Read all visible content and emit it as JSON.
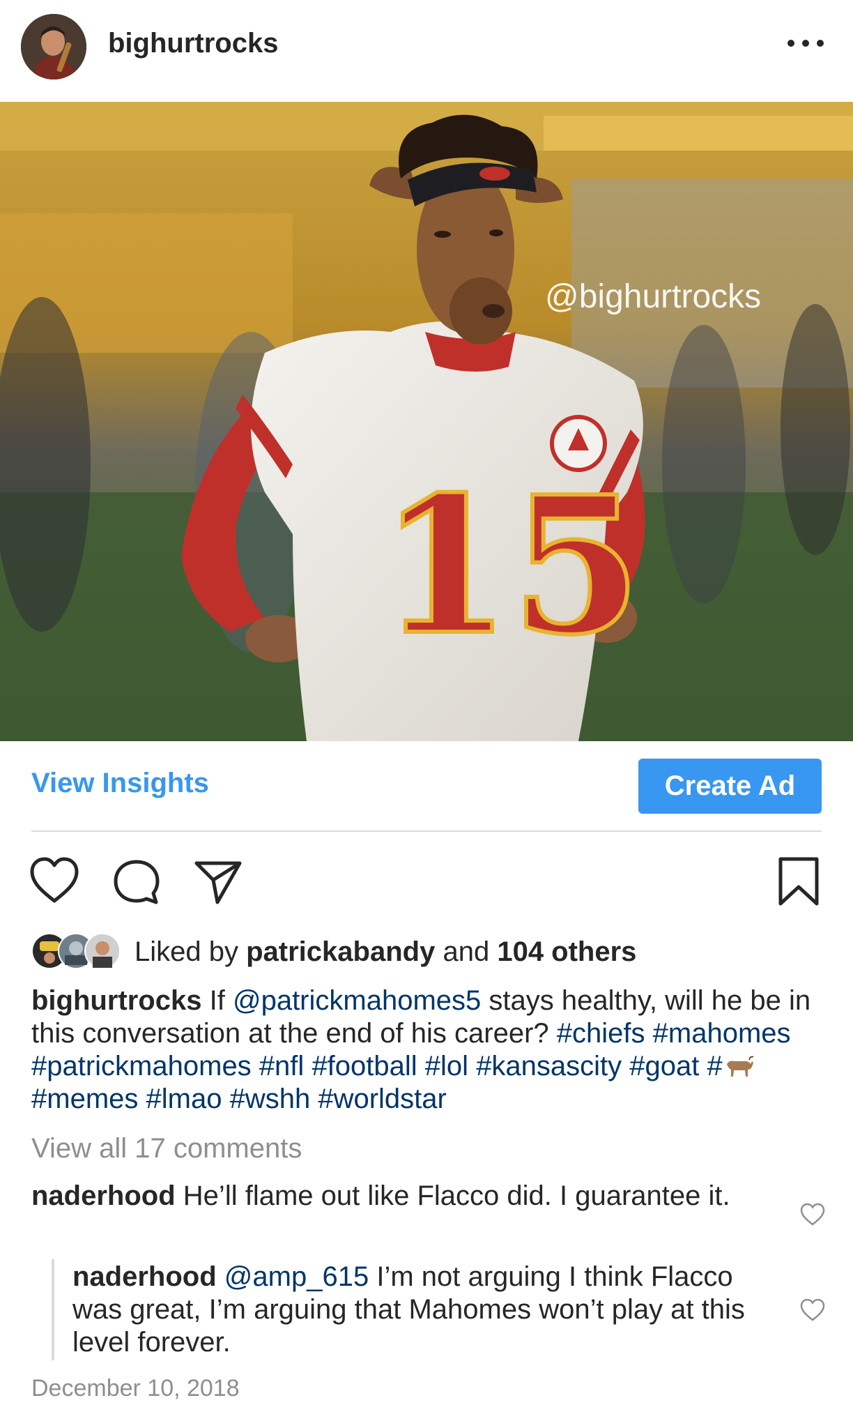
{
  "post": {
    "username": "bighurtrocks",
    "watermark": "@bighurtrocks",
    "photo_jersey_number": "15"
  },
  "insights": {
    "view_insights_label": "View Insights",
    "create_ad_label": "Create Ad"
  },
  "likes": {
    "prefix": "Liked by",
    "user": "patrickabandy",
    "and": "and",
    "others": "104 others"
  },
  "caption": {
    "username": "bighurtrocks",
    "text_before": "If",
    "mention": "@patrickmahomes5",
    "text_after": "stays healthy, will he be in this conversation at the end of his career?",
    "tags_a": [
      "#chiefs",
      "#mahomes",
      "#patrickmahomes",
      "#nfl",
      "#football",
      "#lol",
      "#kansascity",
      "#goat"
    ],
    "goat_tag_prefix": "#",
    "tags_b": [
      "#memes",
      "#lmao",
      "#wshh",
      "#worldstar"
    ]
  },
  "comments": {
    "view_all": "View all 17 comments",
    "items": [
      {
        "username": "naderhood",
        "mention": "",
        "text": "He’ll flame out like Flacco did. I guarantee it."
      },
      {
        "username": "naderhood",
        "mention": "@amp_615",
        "text": "I’m not arguing I think Flacco was great, I’m arguing that Mahomes won’t play at this level forever."
      }
    ]
  },
  "date": "December 10, 2018",
  "colors": {
    "accent_blue": "#3897f0",
    "link_dark_blue": "#003569",
    "muted_gray": "#8e8e8e",
    "text": "#262626"
  },
  "icons": [
    "more-options-icon",
    "heart-icon",
    "comment-icon",
    "share-icon",
    "bookmark-icon",
    "small-heart-icon",
    "goat-emoji"
  ]
}
